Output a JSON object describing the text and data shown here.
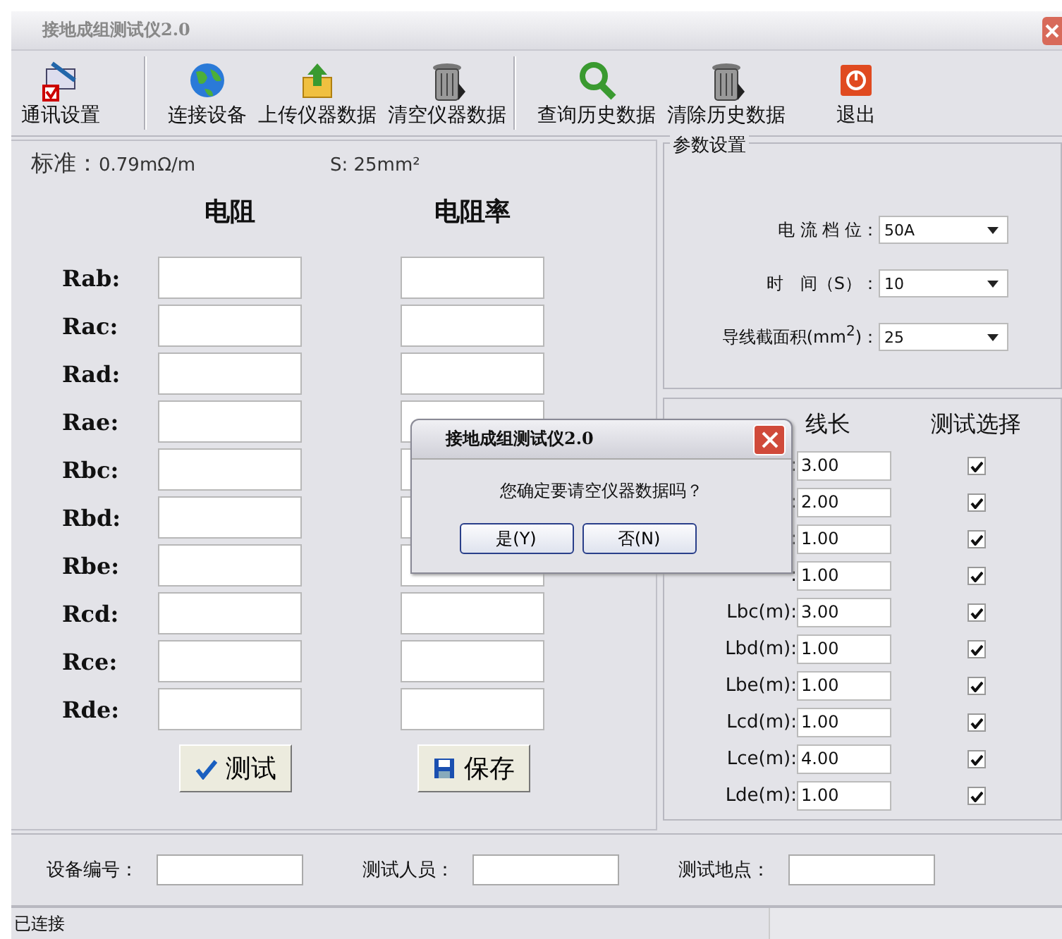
{
  "window": {
    "title": "接地成组测试仪2.0"
  },
  "toolbar": [
    {
      "label": "通讯设置",
      "kind": "settings",
      "separator_before": false
    },
    {
      "label": "连接设备",
      "kind": "globe",
      "separator_before": true
    },
    {
      "label": "上传仪器数据",
      "kind": "upload",
      "separator_before": false
    },
    {
      "label": "清空仪器数据",
      "kind": "trash",
      "separator_before": false
    },
    {
      "label": "查询历史数据",
      "kind": "search",
      "separator_before": true
    },
    {
      "label": "清除历史数据",
      "kind": "trash",
      "separator_before": false
    },
    {
      "label": "退出",
      "kind": "exit",
      "separator_before": false
    }
  ],
  "standard": {
    "label": "标准：",
    "value": "0.79mΩ/m",
    "section": "S: 25mm²"
  },
  "columns": [
    "电阻",
    "电阻率"
  ],
  "resistances": [
    {
      "label": "Rab:"
    },
    {
      "label": "Rac:"
    },
    {
      "label": "Rad:"
    },
    {
      "label": "Rae:"
    },
    {
      "label": "Rbc:"
    },
    {
      "label": "Rbd:"
    },
    {
      "label": "Rbe:"
    },
    {
      "label": "Rcd:"
    },
    {
      "label": "Rce:"
    },
    {
      "label": "Rde:"
    }
  ],
  "test_button": "测试",
  "save_button": "保存",
  "parameters": {
    "title": "参数设置",
    "settings": [
      {
        "label": "电 流 档 位：",
        "value": "50A"
      },
      {
        "label": "时　间（S）：",
        "value": "10"
      },
      {
        "label": "导线截面积(mm$^{2}$)：",
        "value": "25"
      }
    ]
  },
  "lengths": {
    "columns": [
      "线长",
      "测试选择"
    ],
    "rows": [
      {
        "label": ":",
        "value": "3.00",
        "checked": true
      },
      {
        "label": ":",
        "value": "2.00",
        "checked": true
      },
      {
        "label": ":",
        "value": "1.00",
        "checked": true
      },
      {
        "label": ":",
        "value": "1.00",
        "checked": true
      },
      {
        "label": "Lbc(m):",
        "value": "3.00",
        "checked": true
      },
      {
        "label": "Lbd(m):",
        "value": "1.00",
        "checked": true
      },
      {
        "label": "Lbe(m):",
        "value": "1.00",
        "checked": true
      },
      {
        "label": "Lcd(m):",
        "value": "1.00",
        "checked": true
      },
      {
        "label": "Lce(m):",
        "value": "4.00",
        "checked": true
      },
      {
        "label": "Lde(m):",
        "value": "1.00",
        "checked": true
      }
    ]
  },
  "info_fields": [
    {
      "label": "设备编号："
    },
    {
      "label": "测试人员："
    },
    {
      "label": "测试地点："
    }
  ],
  "status_bar": "已连接",
  "dialog": {
    "title": "接地成组测试仪2.0",
    "message": "您确定要请空仪器数据吗？",
    "buttons": [
      "是(Y)",
      "否(N)"
    ]
  }
}
